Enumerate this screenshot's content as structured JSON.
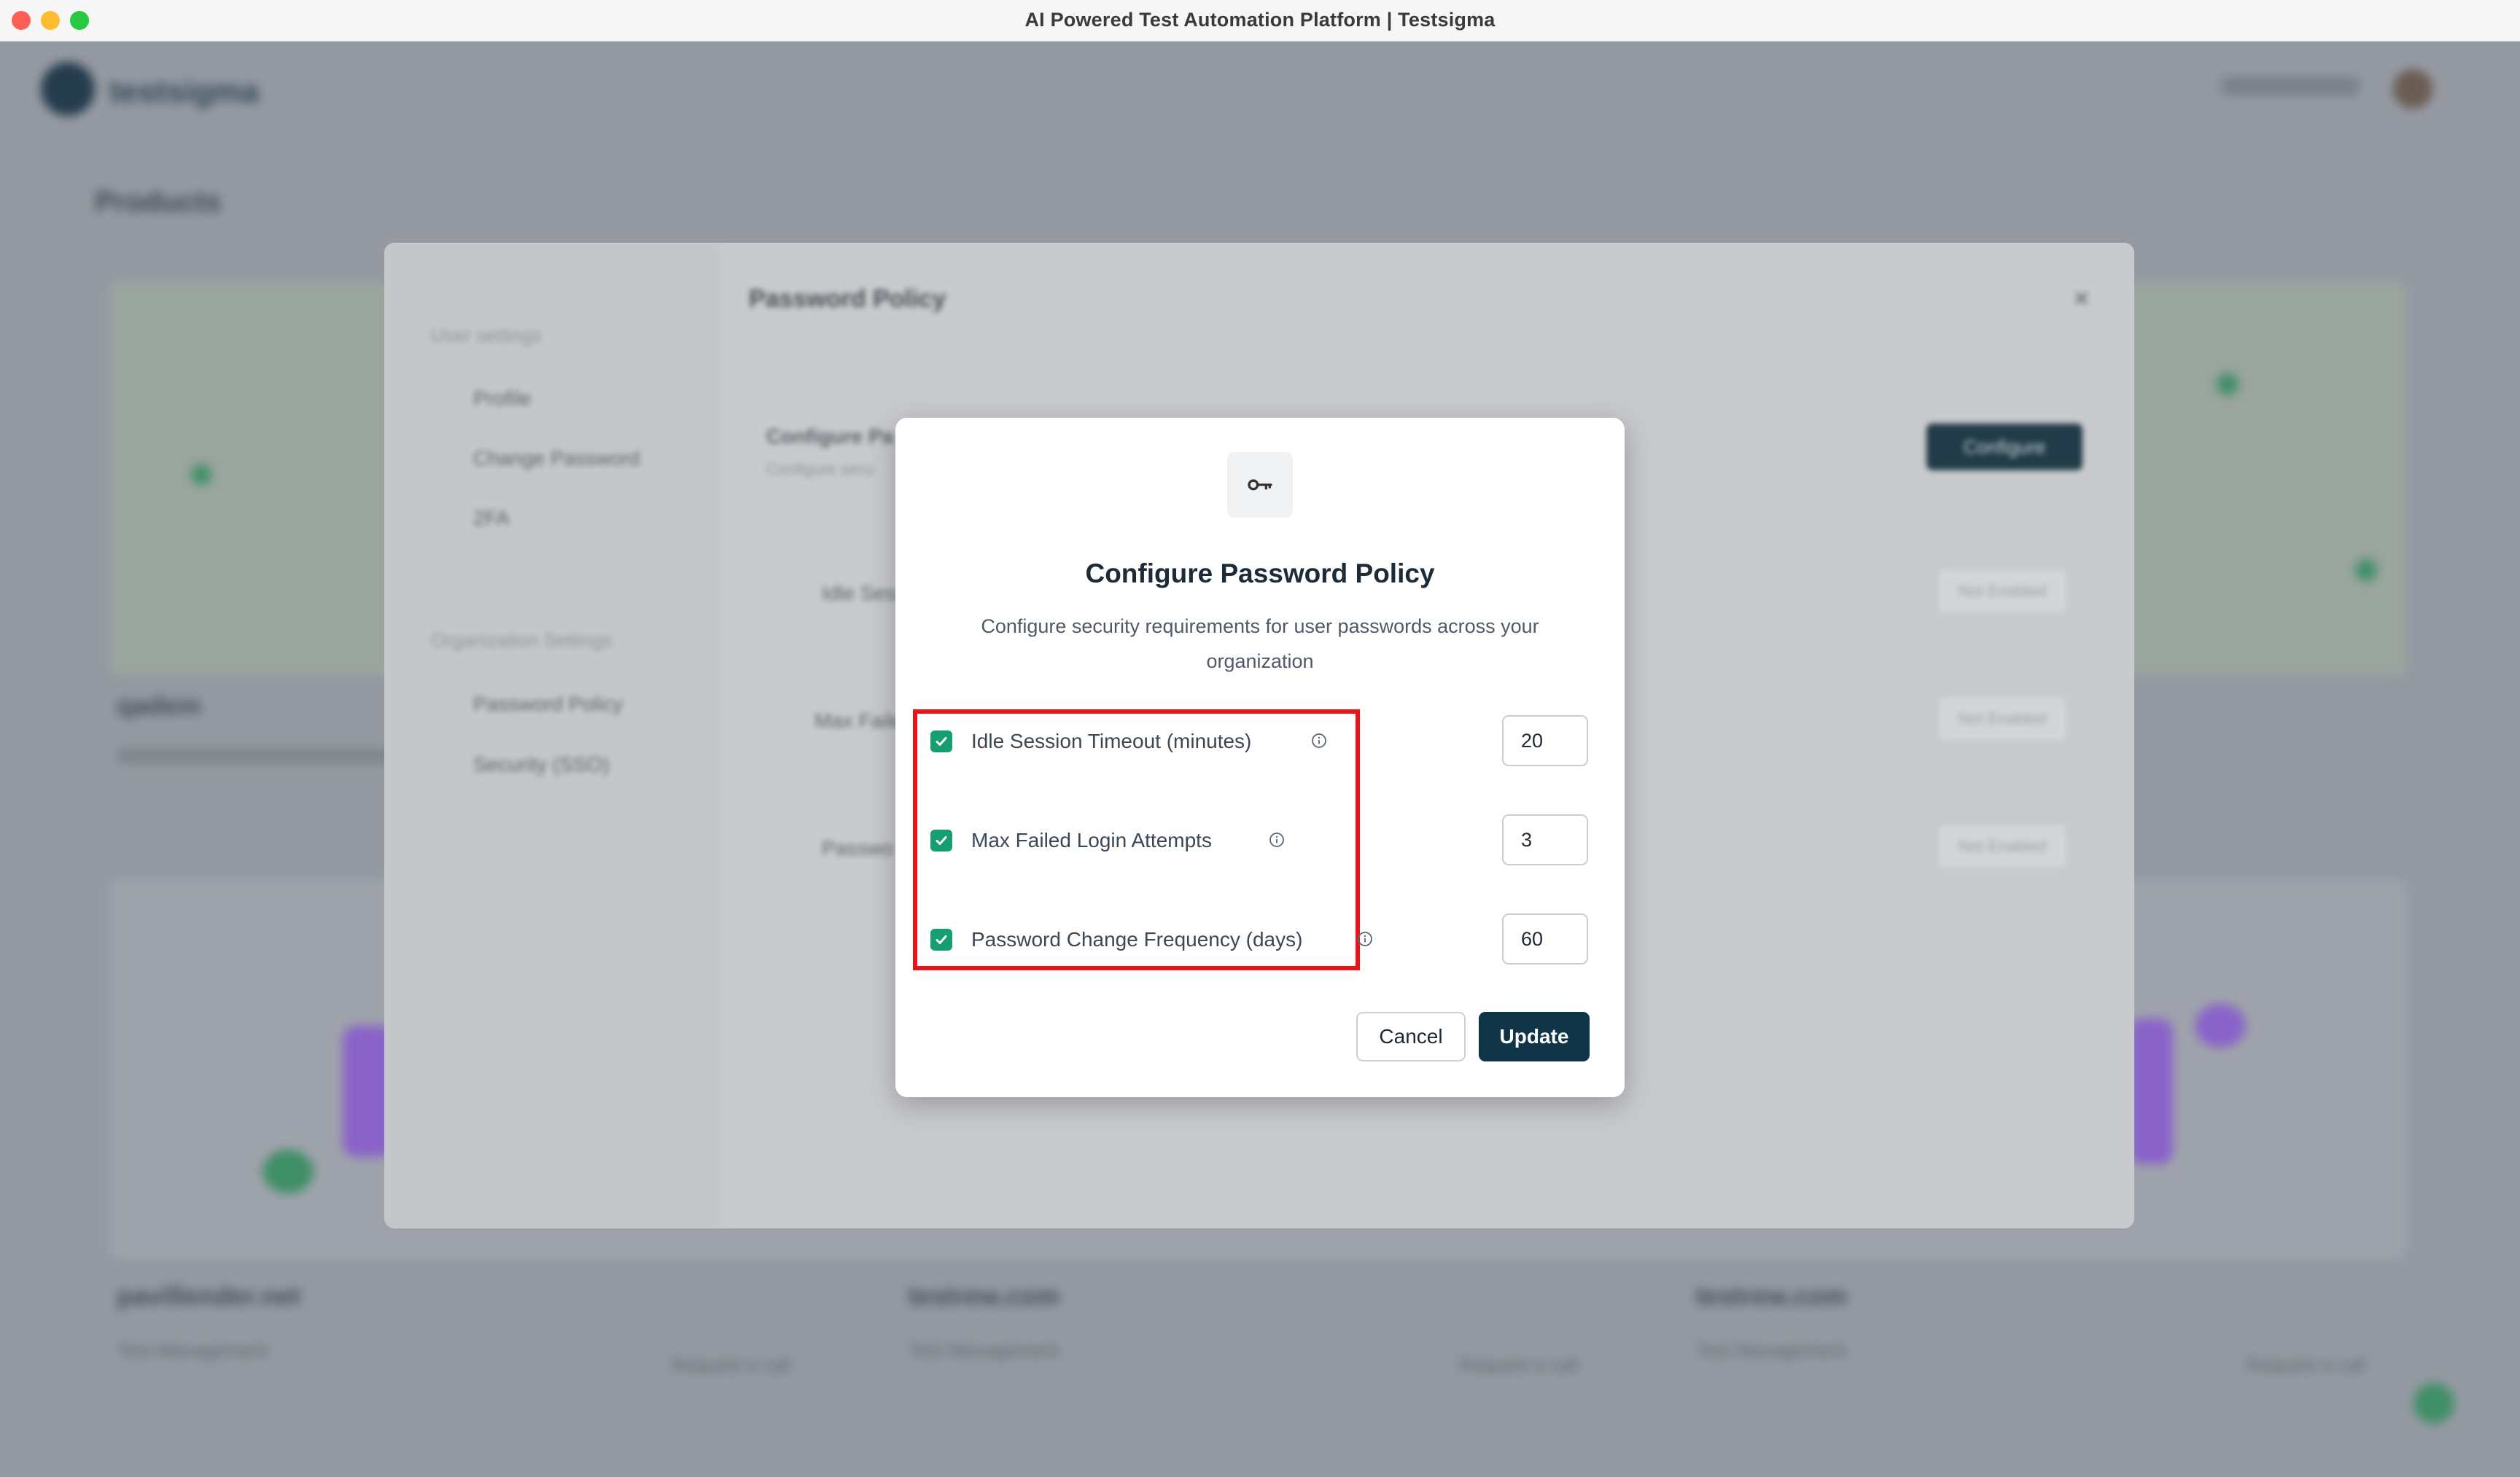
{
  "window": {
    "title": "AI Powered Test Automation Platform | Testsigma"
  },
  "background": {
    "brand": "testsigma",
    "page_title": "Products",
    "cards": [
      "qadem",
      "pavillender.net",
      "testrew.com",
      "testrew.com"
    ],
    "card_subtitle": "Test Management",
    "request_access": "Request a call"
  },
  "settings_panel": {
    "user_settings_heading": "User settings",
    "user_items": [
      "Profile",
      "Change Password",
      "2FA"
    ],
    "org_settings_heading": "Organization Settings",
    "org_items": [
      "Password Policy",
      "Security (SSO)"
    ],
    "title": "Password Policy",
    "configure_button": "Configure",
    "section_title": "Configure Pa",
    "section_sub": "Configure secu",
    "row_labels": [
      "Idle Sess",
      "Max Faile",
      "Passwo"
    ],
    "row_status": "Not Enabled"
  },
  "modal": {
    "icon": "key-icon",
    "title": "Configure Password Policy",
    "subtitle": "Configure security requirements for user passwords across your organization",
    "fields": [
      {
        "label": "Idle Session Timeout (minutes)",
        "checked": true,
        "value": "20"
      },
      {
        "label": "Max Failed Login Attempts",
        "checked": true,
        "value": "3"
      },
      {
        "label": "Password Change Frequency (days)",
        "checked": true,
        "value": "60"
      }
    ],
    "cancel_label": "Cancel",
    "update_label": "Update"
  },
  "colors": {
    "highlight": "#e8141a",
    "checkbox": "#169e6f",
    "primary_button": "#0f3447"
  }
}
